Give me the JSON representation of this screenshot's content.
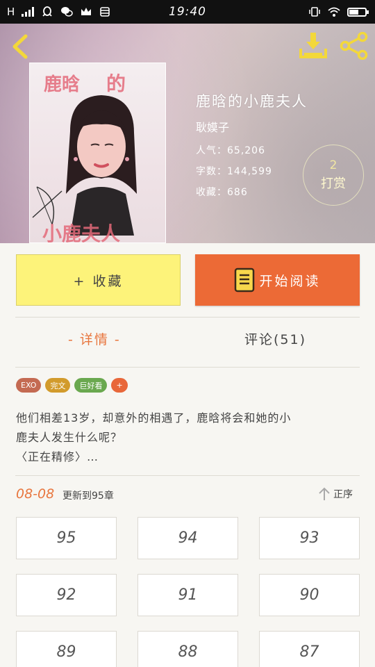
{
  "status_bar": {
    "network": "H",
    "time": "19:40"
  },
  "book": {
    "title": "鹿晗的小鹿夫人",
    "author": "耿嫫子",
    "popularity": "人气：65,206",
    "word_count": "字数：144,599",
    "favorites": "收藏：686",
    "tip_count": "2",
    "tip_label": "打赏",
    "cover_words": [
      "鹿晗",
      "的",
      "小鹿夫人"
    ]
  },
  "actions": {
    "favorite_label": "+ 收藏",
    "read_label": "开始阅读"
  },
  "tabs": {
    "detail": "- 详情 -",
    "comments": "评论(51)"
  },
  "tags": [
    {
      "label": "EXO",
      "color": "#c46a52"
    },
    {
      "label": "完文",
      "color": "#d29b2c"
    },
    {
      "label": "巨好看",
      "color": "#6aa84f"
    },
    {
      "label": "+",
      "color": "#e8673a"
    }
  ],
  "description": {
    "line1": "他们相差13岁，却意外的相遇了，鹿晗将会和她的小",
    "line2": "鹿夫人发生什么呢？",
    "line3": "〈正在精修〉…"
  },
  "chapters": {
    "date": "08-08",
    "update_text": "更新到95章",
    "sort_label": "正序",
    "items": [
      "95",
      "94",
      "93",
      "92",
      "91",
      "90",
      "89",
      "88",
      "87"
    ]
  },
  "colors": {
    "accent": "#e8763e",
    "favorite_bg": "#fdf37a",
    "read_bg": "#ec6a36"
  }
}
